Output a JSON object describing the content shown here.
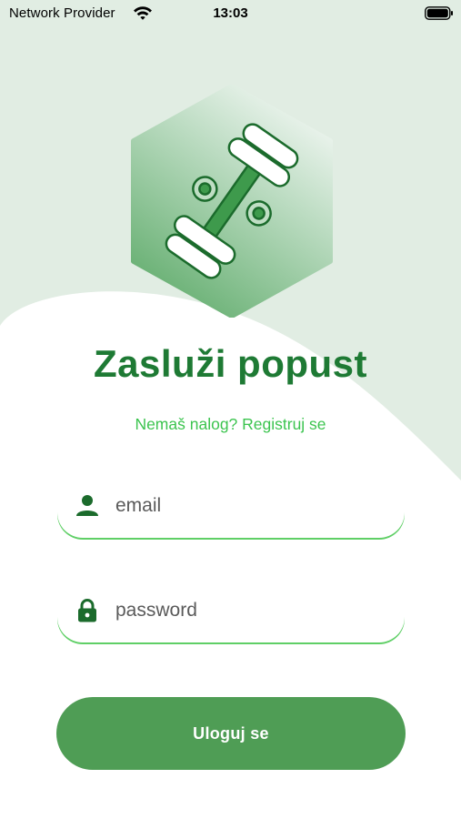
{
  "status_bar": {
    "carrier": "Network Provider",
    "time": "13:03",
    "wifi_icon": "wifi-icon",
    "battery_icon": "battery-icon"
  },
  "logo": {
    "icon": "dumbbell-percent-icon"
  },
  "title": "Zasluži popust",
  "register_link": "Nemaš nalog? Registruj se",
  "form": {
    "email": {
      "icon": "person-icon",
      "value": "",
      "placeholder": "email"
    },
    "password": {
      "icon": "lock-icon",
      "value": "",
      "placeholder": "password"
    }
  },
  "login_button": "Uloguj se",
  "colors": {
    "primary_green": "#4f9d55",
    "title_green": "#1e7a34",
    "link_green": "#3cc44f",
    "background_tint": "#e1ede3",
    "field_underline": "#5fcf66"
  }
}
